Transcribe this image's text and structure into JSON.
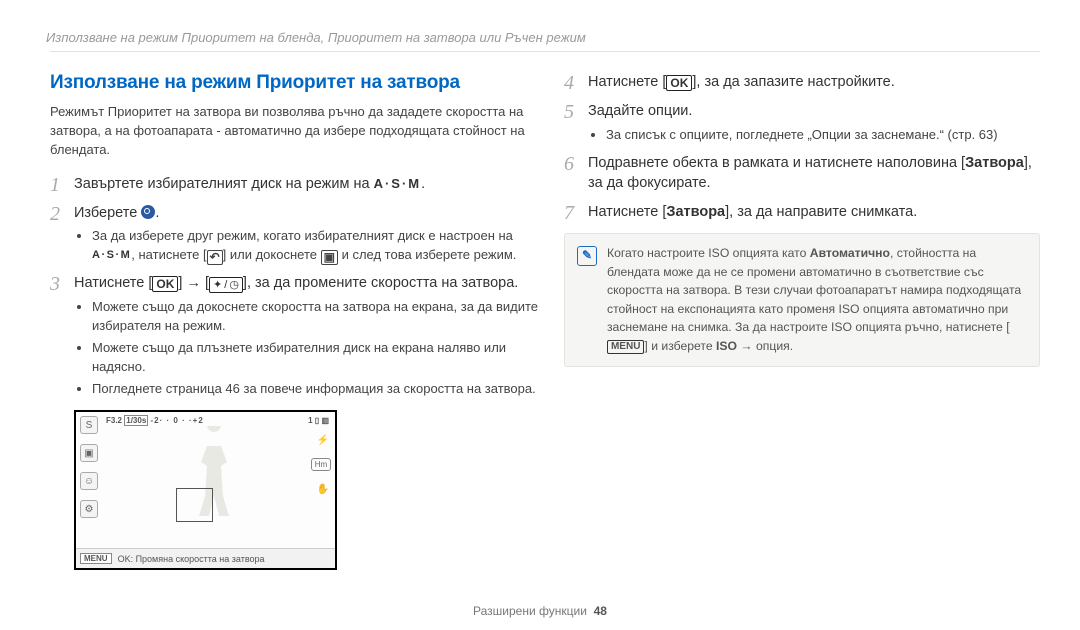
{
  "header": "Използване на режим Приоритет на бленда, Приоритет на затвора или Ръчен режим",
  "section_title": "Използване на режим Приоритет на затвора",
  "intro": "Режимът Приоритет на затвора ви позволява ръчно да зададете скоростта на затвора, а на фотоапарата - автоматично да избере подходящата стойност на блендата.",
  "step1_text": "Завъртете избирателният диск на режим на ",
  "asm_label": "A·S·M",
  "step2_text": "Изберете ",
  "sub2_a_pre": "За да изберете друг режим, когато избирателният диск е настроен на",
  "sub2_a_asm_label": "A·S·M",
  "sub2_a_mid": ", натиснете [",
  "sub2_a_back_icon": "↶",
  "sub2_a_mid2": "] или докоснете ",
  "sub2_a_cam_icon": "▣",
  "sub2_a_post": " и след това изберете режим.",
  "step3_pre": "Натиснете [",
  "ok_label": "OK",
  "step3_arrow": "→",
  "step3_left_glyph": "✦",
  "step3_right_glyph": "◷",
  "step3_post": "], за да промените скоростта на затвора.",
  "sub3_a": "Можете също да докоснете скоростта на затвора на екрана, за да видите избирателя на режим.",
  "sub3_b": "Можете също да плъзнете избирателния диск на екрана наляво или надясно.",
  "sub3_c": "Погледнете страница 46 за повече информация за скоростта на затвора.",
  "lcd": {
    "f": "F3.2",
    "shutter": "1/30s",
    "scale_left": "-2",
    "scale_right": "+2",
    "count": "1",
    "menu_label": "MENU",
    "bottom_text": "OK: Промяна скоростта на затвора"
  },
  "step4_pre": "Натиснете [",
  "step4_post": "], за да запазите настройките.",
  "step5_text": "Задайте опции.",
  "sub5_a": "За списък с опциите, погледнете „Опции за заснемане.“ (стр. 63)",
  "step6_pre": "Подравнете обекта в рамката и натиснете наполовина [",
  "step6_shutter": "Затвора",
  "step6_post": "], за да фокусирате.",
  "step7_pre": "Натиснете [",
  "step7_shutter": "Затвора",
  "step7_post": "], за да направите снимката.",
  "note_pre": "Когато настроите ISO опцията като ",
  "note_bold1": "Автоматично",
  "note_mid": ", стойността на блендата може да не се промени автоматично в съответствие със скоростта на затвора. В тези случаи фотоапаратът намира подходящата стойност на експонацията като променя ISO опцията автоматично при заснемане на снимка. За да настроите ISO опцията ръчно, натиснете [",
  "note_menu": "MENU",
  "note_mid2": "] и изберете ",
  "note_bold2": "ISO",
  "note_arrow": "→",
  "note_post": " опция.",
  "footer_label": "Разширени функции",
  "footer_page": "48"
}
